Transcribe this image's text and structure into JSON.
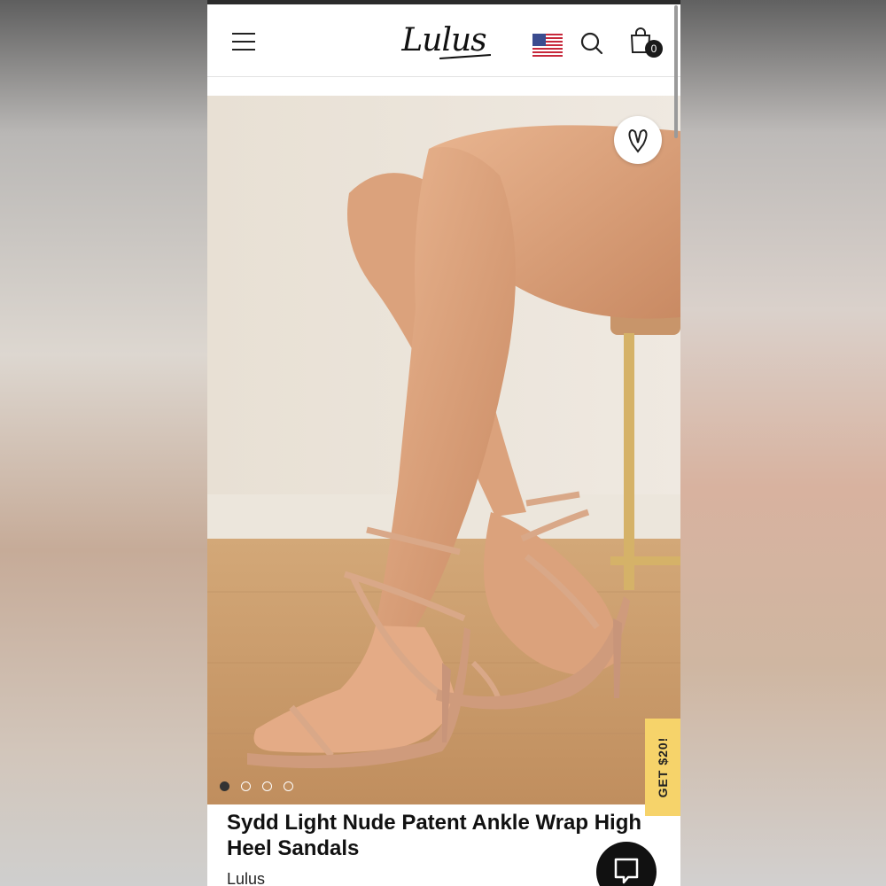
{
  "header": {
    "logo_text": "Lulus",
    "cart_count": "0",
    "icons": {
      "menu": "hamburger-menu-icon",
      "flag": "us-flag-icon",
      "search": "search-icon",
      "cart": "shopping-bag-icon"
    }
  },
  "gallery": {
    "image_count": 4,
    "active_index": 0,
    "favorite_icon": "heart-icon"
  },
  "promo": {
    "label": "GET $20!"
  },
  "product": {
    "title": "Sydd Light Nude Patent Ankle Wrap High Heel Sandals",
    "brand": "Lulus"
  },
  "chat": {
    "icon": "chat-icon"
  },
  "colors": {
    "promo_yellow": "#f6d36a",
    "dark": "#111111"
  }
}
